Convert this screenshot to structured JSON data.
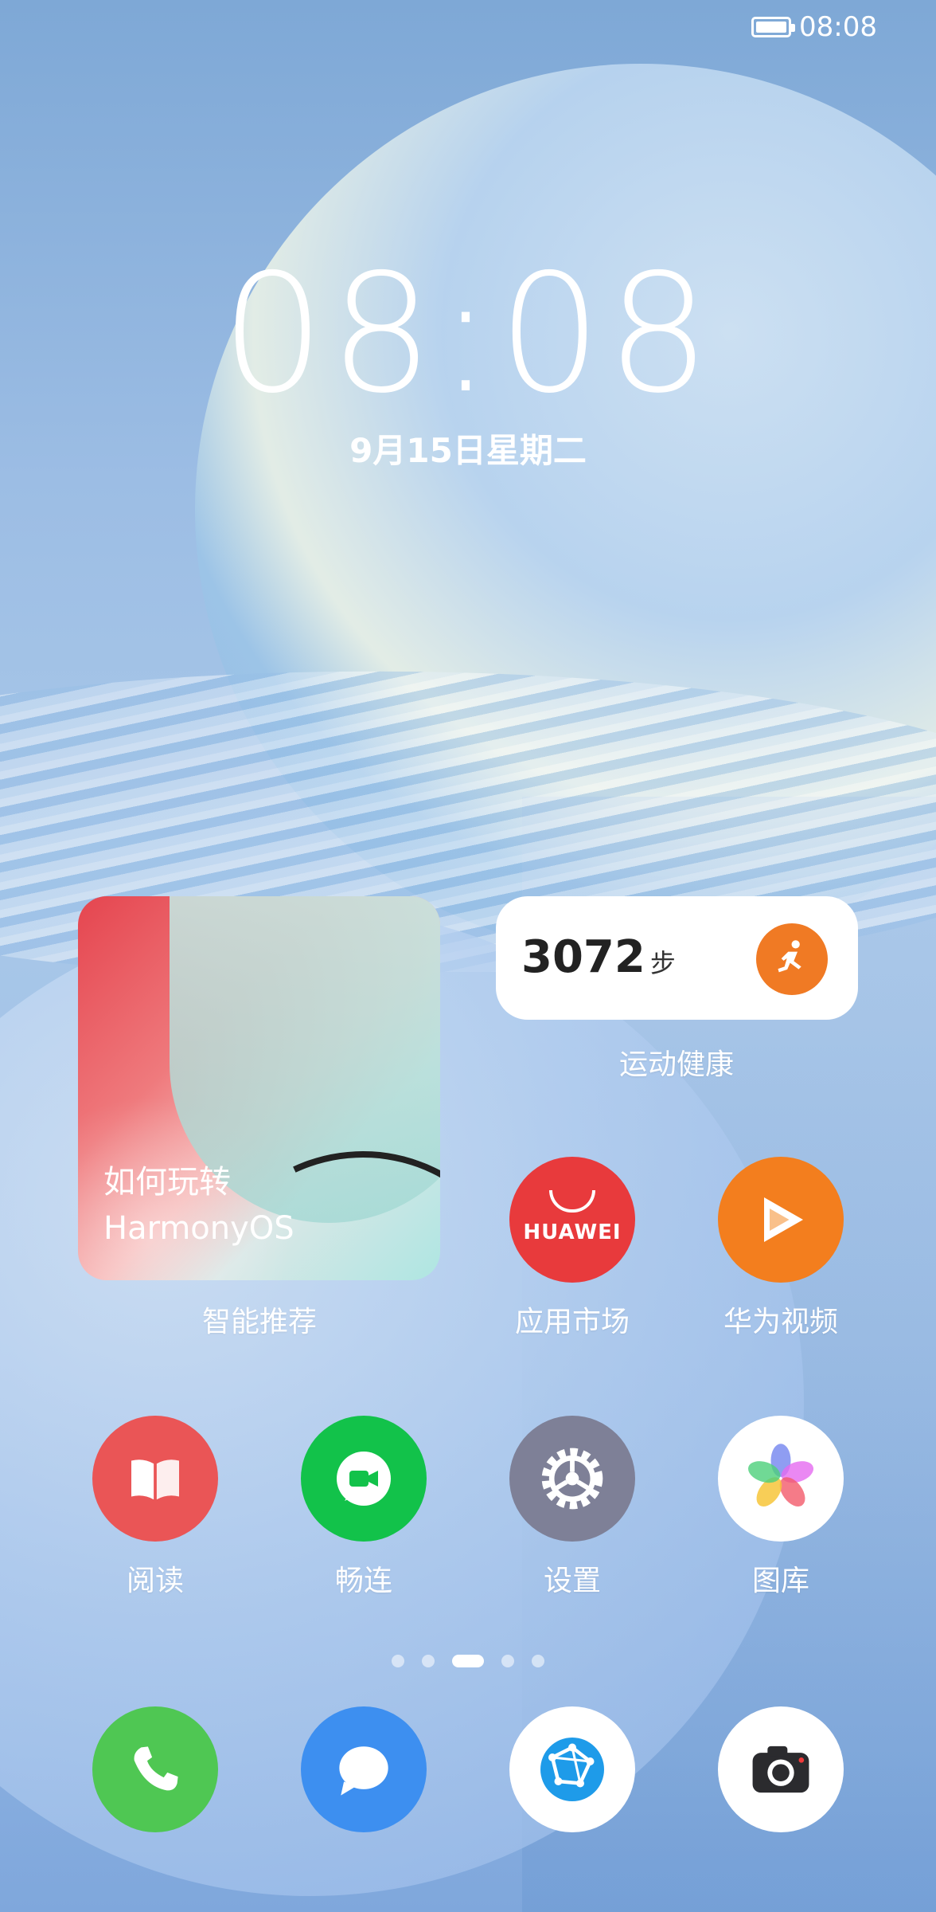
{
  "status_bar": {
    "time": "08:08",
    "battery_icon": "battery-icon"
  },
  "lock_clock": {
    "time": "08:08",
    "date": "9月15日星期二"
  },
  "widgets": {
    "recommend": {
      "line1": "如何玩转",
      "line2": "HarmonyOS",
      "label": "智能推荐"
    },
    "health": {
      "steps": "3072",
      "unit": "步",
      "label": "运动健康",
      "icon": "running-person-icon"
    }
  },
  "apps": {
    "market": {
      "label": "应用市场",
      "brand": "HUAWEI",
      "color": "#e83a3c"
    },
    "video": {
      "label": "华为视频",
      "color": "#f37e1e"
    },
    "reader": {
      "label": "阅读",
      "color": "#ea5556"
    },
    "meetime": {
      "label": "畅连",
      "color": "#12c24a"
    },
    "settings": {
      "label": "设置",
      "color": "#7e8097"
    },
    "gallery": {
      "label": "图库",
      "color": "#ffffff"
    }
  },
  "page_indicator": {
    "pages": 5,
    "active": 3
  },
  "dock": [
    {
      "name": "phone",
      "icon": "phone-icon",
      "color": "#4fc753"
    },
    {
      "name": "messages",
      "icon": "message-bubble-icon",
      "color": "#3d8ff0"
    },
    {
      "name": "browser",
      "icon": "browser-globe-icon",
      "color": "#ffffff"
    },
    {
      "name": "camera",
      "icon": "camera-icon",
      "color": "#ffffff"
    }
  ]
}
